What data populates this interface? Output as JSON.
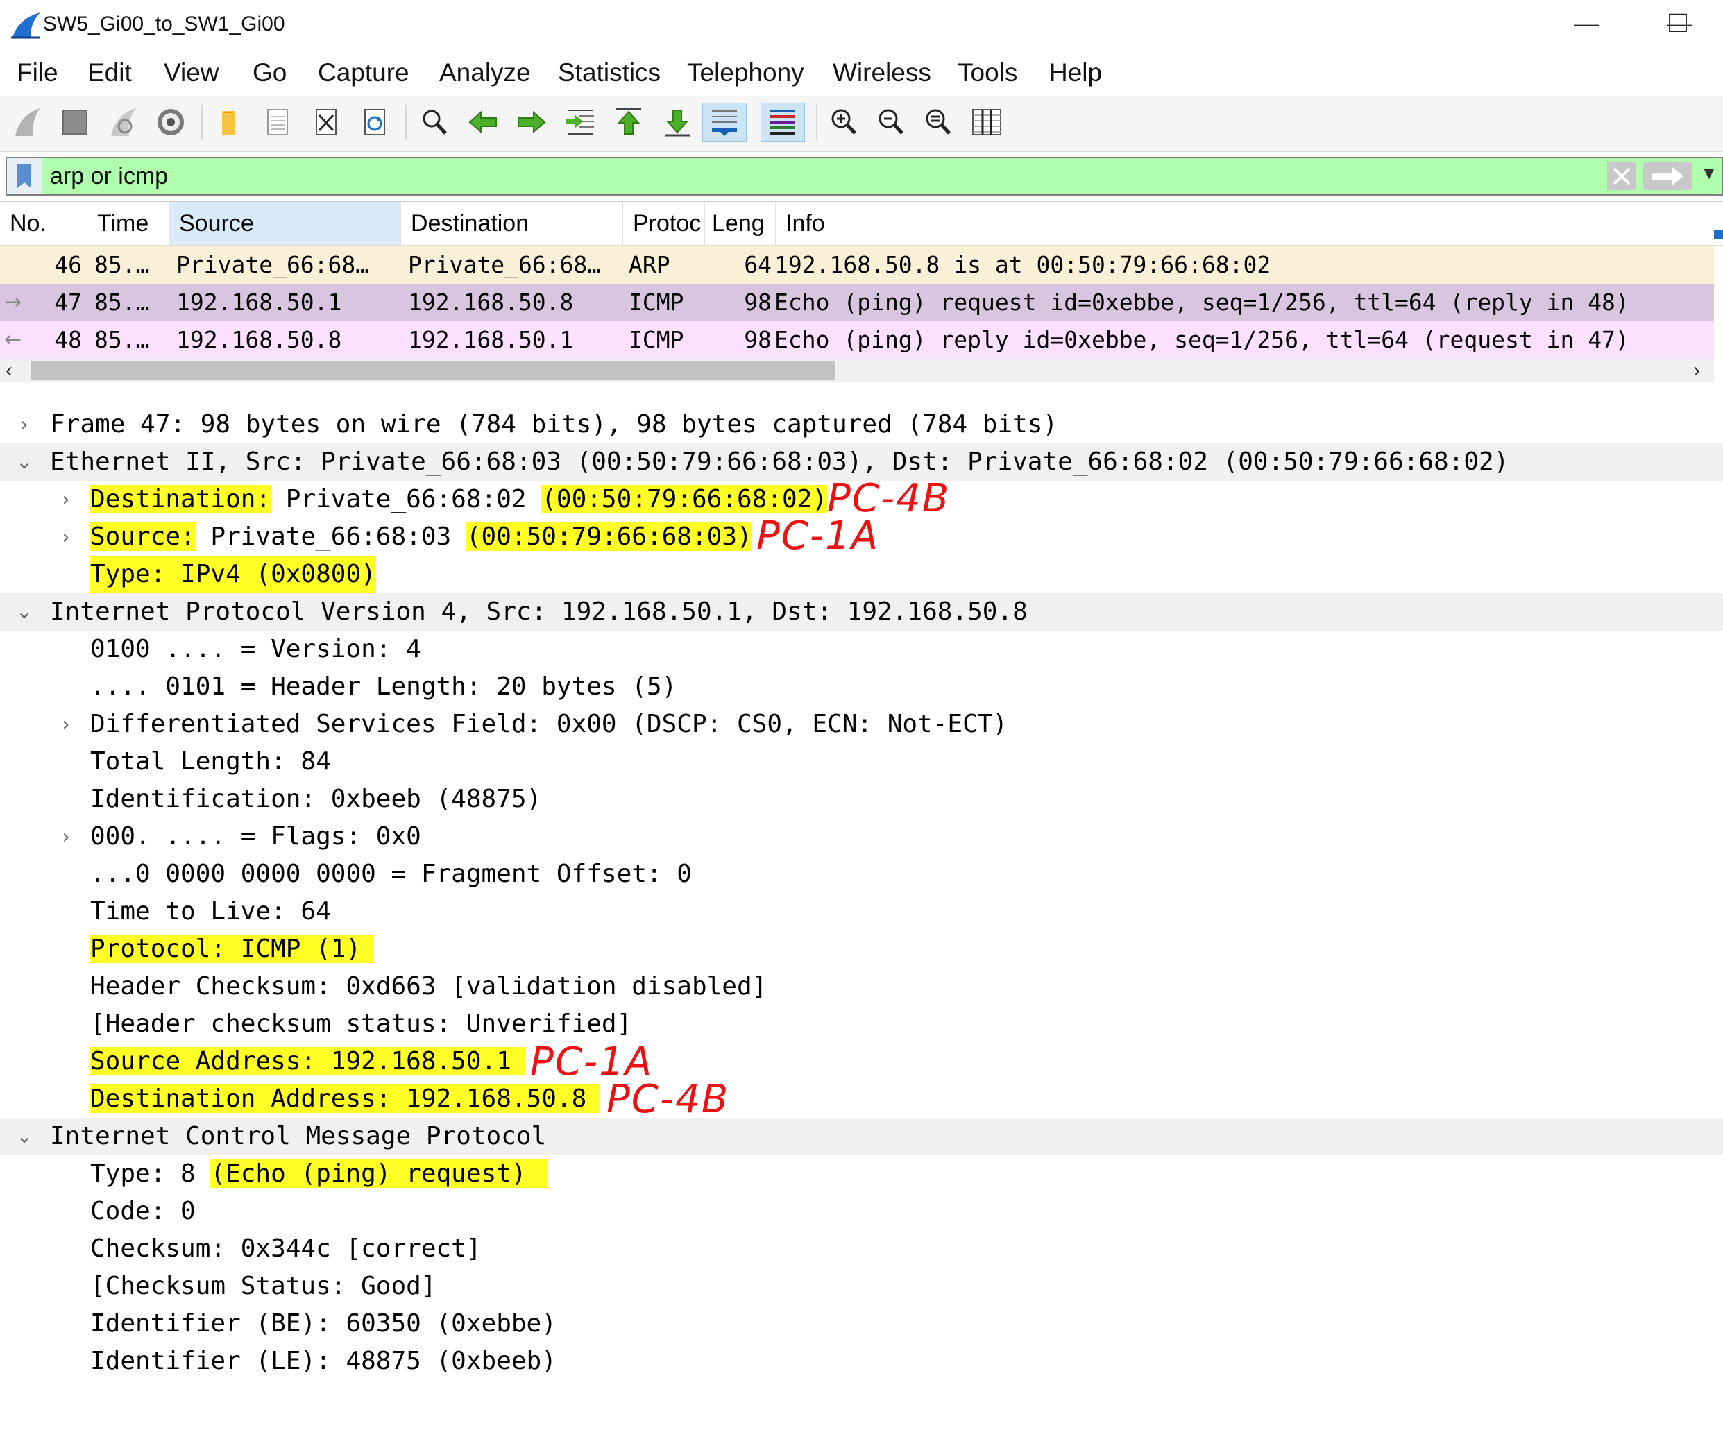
{
  "window": {
    "title": "SW5_Gi00_to_SW1_Gi00",
    "minimize_glyph": "—",
    "maximize_glyph": "☐"
  },
  "menu": [
    "File",
    "Edit",
    "View",
    "Go",
    "Capture",
    "Analyze",
    "Statistics",
    "Telephony",
    "Wireless",
    "Tools",
    "Help"
  ],
  "toolbar_icons": [
    "start-capture-icon",
    "stop-capture-icon",
    "restart-capture-icon",
    "capture-options-icon",
    "open-file-icon",
    "save-file-icon",
    "close-file-icon",
    "reload-file-icon",
    "find-packet-icon",
    "go-back-icon",
    "go-forward-icon",
    "go-to-packet-icon",
    "first-packet-icon",
    "last-packet-icon",
    "auto-scroll-icon",
    "colorize-icon",
    "zoom-in-icon",
    "zoom-out-icon",
    "normal-size-icon",
    "resize-columns-icon"
  ],
  "filter": {
    "value": "arp or icmp"
  },
  "packet_list": {
    "columns": [
      "No.",
      "Time",
      "Source",
      "Destination",
      "Protoc",
      "Leng",
      "Info"
    ],
    "rows": [
      {
        "no": "46",
        "time": "85.…",
        "src": "Private_66:68…",
        "dst": "Private_66:68…",
        "proto": "ARP",
        "len": "64",
        "info": "192.168.50.8 is at 00:50:79:66:68:02",
        "bg": "#faf0d7"
      },
      {
        "no": "47",
        "time": "85.…",
        "src": "192.168.50.1",
        "dst": "192.168.50.8",
        "proto": "ICMP",
        "len": "98",
        "info": "Echo (ping) request  id=0xebbe, seq=1/256, ttl=64 (reply in 48)",
        "bg": "#d8c5df"
      },
      {
        "no": "48",
        "time": "85.…",
        "src": "192.168.50.8",
        "dst": "192.168.50.1",
        "proto": "ICMP",
        "len": "98",
        "info": "Echo (ping) reply    id=0xebbe, seq=1/256, ttl=64 (request in 47)",
        "bg": "#fce0ff"
      }
    ]
  },
  "details": {
    "frame": "Frame 47: 98 bytes on wire (784 bits), 98 bytes captured (784 bits)",
    "eth_header": "Ethernet II, Src: Private_66:68:03 (00:50:79:66:68:03), Dst: Private_66:68:02 (00:50:79:66:68:02)",
    "eth_dst_label": "Destination:",
    "eth_dst_name": " Private_66:68:02 ",
    "eth_dst_mac": "(00:50:79:66:68:02)",
    "eth_src_label": "Source:",
    "eth_src_name": " Private_66:68:03 ",
    "eth_src_mac": "(00:50:79:66:68:03)",
    "eth_type": "Type: IPv4 (0x0800)",
    "ip_header": "Internet Protocol Version 4, Src: 192.168.50.1, Dst: 192.168.50.8",
    "ip_version": "0100 .... = Version: 4",
    "ip_hlen": ".... 0101 = Header Length: 20 bytes (5)",
    "ip_dsf": "Differentiated Services Field: 0x00 (DSCP: CS0, ECN: Not-ECT)",
    "ip_totlen": "Total Length: 84",
    "ip_id": "Identification: 0xbeeb (48875)",
    "ip_flags": "000. .... = Flags: 0x0",
    "ip_frag": "...0 0000 0000 0000 = Fragment Offset: 0",
    "ip_ttl": "Time to Live: 64",
    "ip_proto": "Protocol: ICMP (1)",
    "ip_cksum": "Header Checksum: 0xd663 [validation disabled]",
    "ip_cksum_status": "[Header checksum status: Unverified]",
    "ip_src": "Source Address: 192.168.50.1",
    "ip_dst": "Destination Address: 192.168.50.8",
    "icmp_header": "Internet Control Message Protocol",
    "icmp_type_label": "Type: 8 ",
    "icmp_type_val": "(Echo (ping) request)",
    "icmp_code": "Code: 0",
    "icmp_cksum": "Checksum: 0x344c [correct]",
    "icmp_cksum_status": "[Checksum Status: Good]",
    "icmp_id_be": "Identifier (BE): 60350 (0xebbe)",
    "icmp_id_le": "Identifier (LE): 48875 (0xbeeb)"
  },
  "annotations": {
    "eth_dst": "PC-4B",
    "eth_src": "PC-1A",
    "ip_src": "PC-1A",
    "ip_dst": "PC-4B"
  },
  "colors": {
    "highlight": "#ffff26",
    "annotation": "#ee1111",
    "filter_ok": "#afffaf"
  }
}
